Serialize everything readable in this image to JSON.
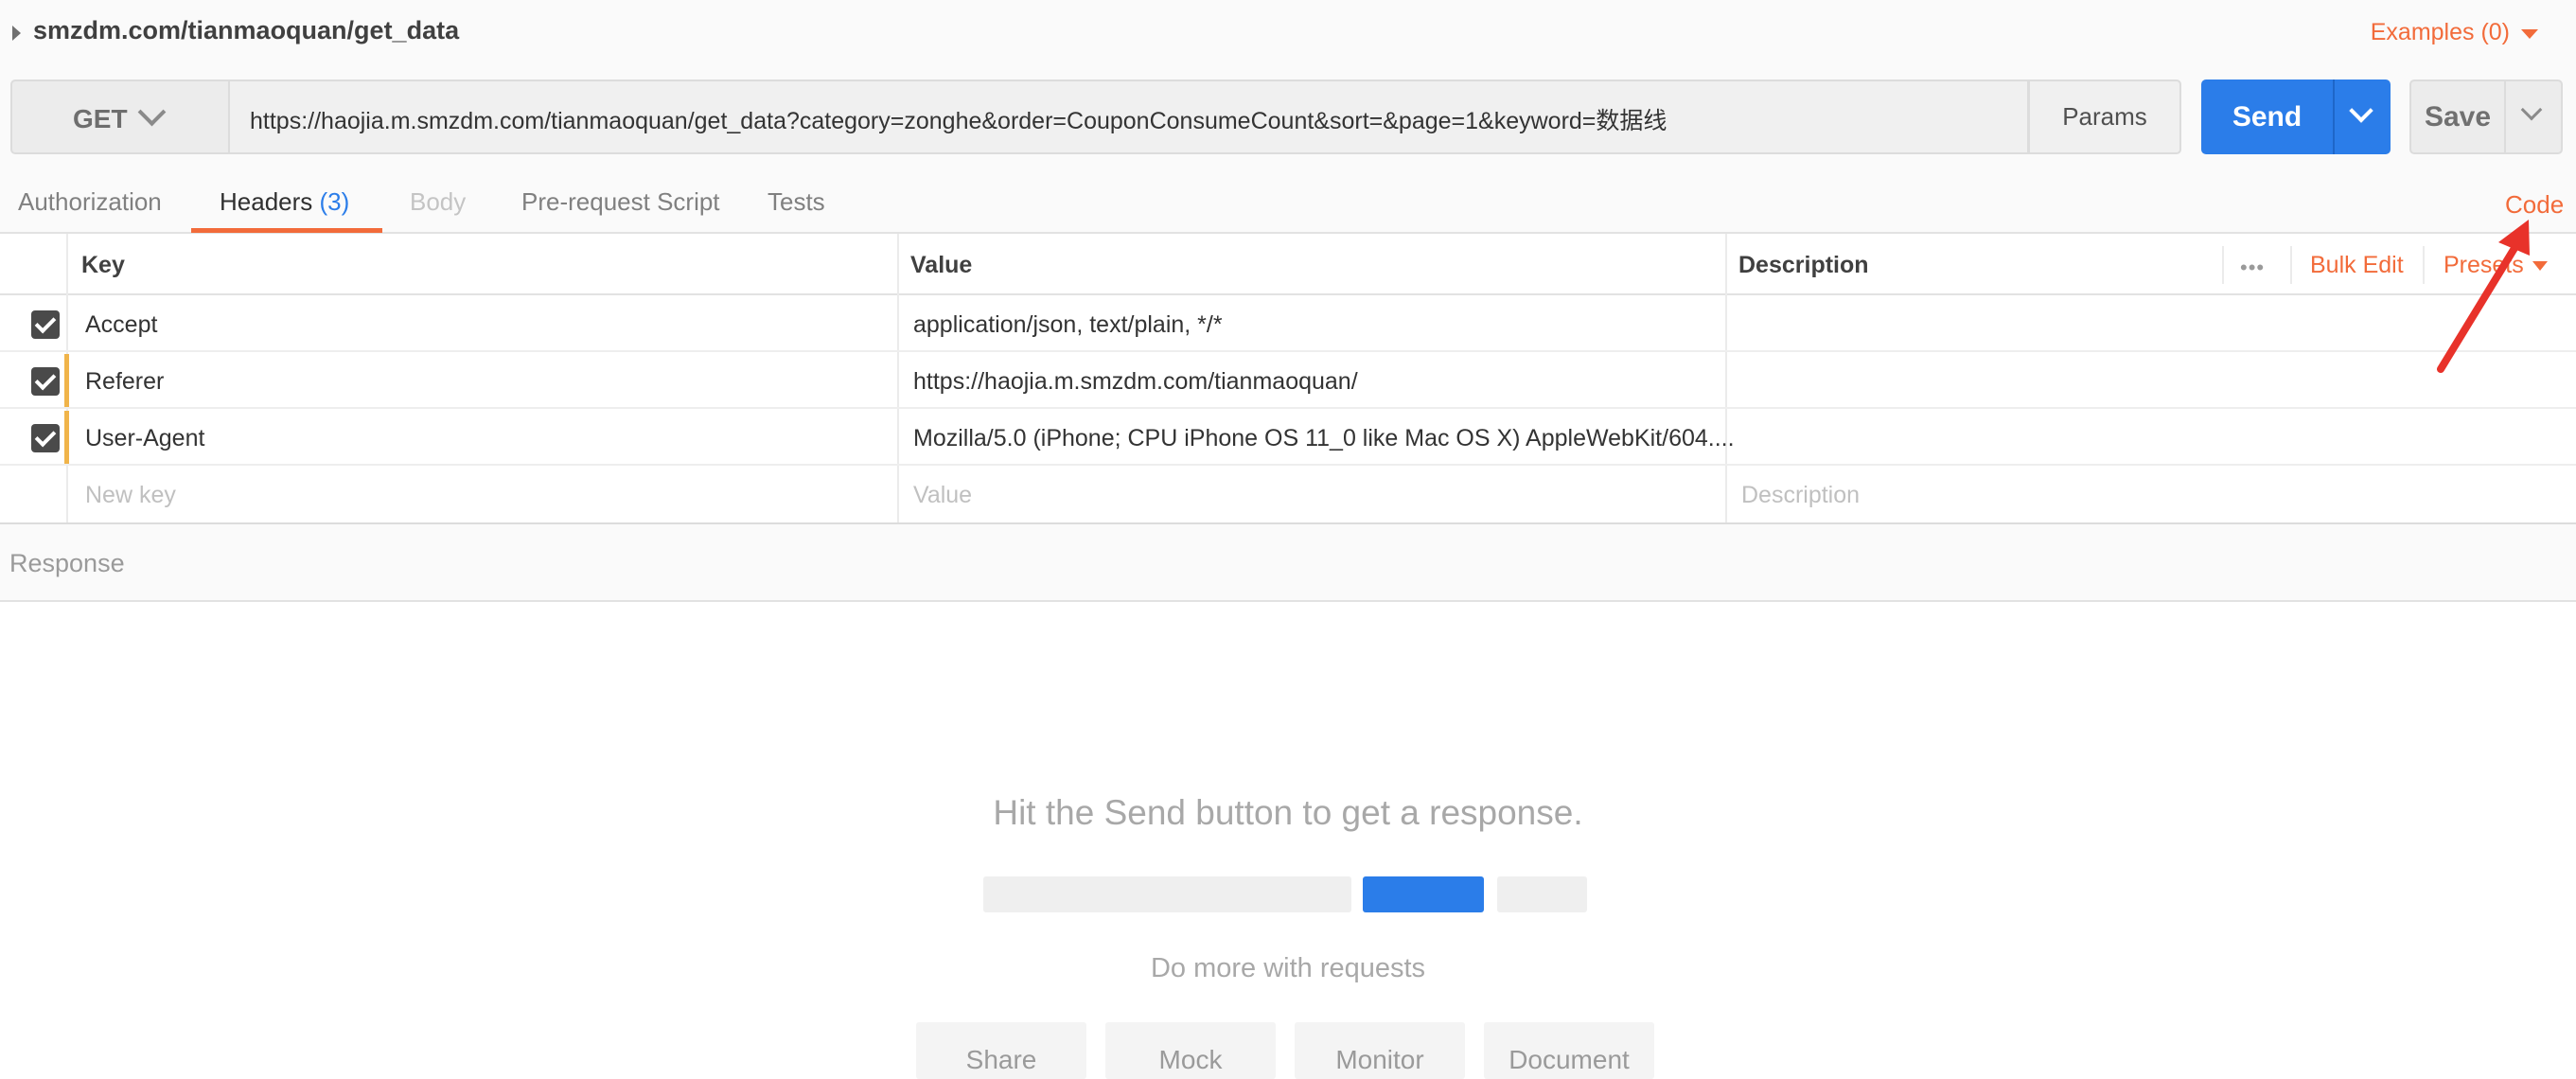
{
  "request": {
    "name": "smzdm.com/tianmaoquan/get_data",
    "examples_label": "Examples (0)",
    "method": "GET",
    "url": "https://haojia.m.smzdm.com/tianmaoquan/get_data?category=zonghe&order=CouponConsumeCount&sort=&page=1&keyword=数据线",
    "params_label": "Params",
    "send_label": "Send",
    "save_label": "Save"
  },
  "tabs": [
    {
      "label": "Authorization"
    },
    {
      "label": "Headers",
      "count": "(3)"
    },
    {
      "label": "Body"
    },
    {
      "label": "Pre-request Script"
    },
    {
      "label": "Tests"
    }
  ],
  "code_link": "Code",
  "headers_table": {
    "columns": {
      "key": "Key",
      "value": "Value",
      "description": "Description"
    },
    "more_icon": "•••",
    "bulk_edit": "Bulk Edit",
    "presets": "Presets",
    "rows": [
      {
        "key": "Accept",
        "value": "application/json, text/plain, */*",
        "description": ""
      },
      {
        "key": "Referer",
        "value": "https://haojia.m.smzdm.com/tianmaoquan/",
        "description": ""
      },
      {
        "key": "User-Agent",
        "value": "Mozilla/5.0 (iPhone; CPU iPhone OS 11_0 like Mac OS X) AppleWebKit/604....",
        "description": ""
      }
    ],
    "new_row": {
      "key_placeholder": "New key",
      "value_placeholder": "Value",
      "description_placeholder": "Description"
    }
  },
  "response": {
    "title": "Response",
    "hint": "Hit the Send button to get a response.",
    "do_more": "Do more with requests",
    "features": [
      "Share",
      "Mock",
      "Monitor",
      "Document"
    ]
  },
  "colors": {
    "accent": "#f26b3a",
    "primary": "#2b7de9",
    "annotation_arrow": "#e8322a"
  }
}
